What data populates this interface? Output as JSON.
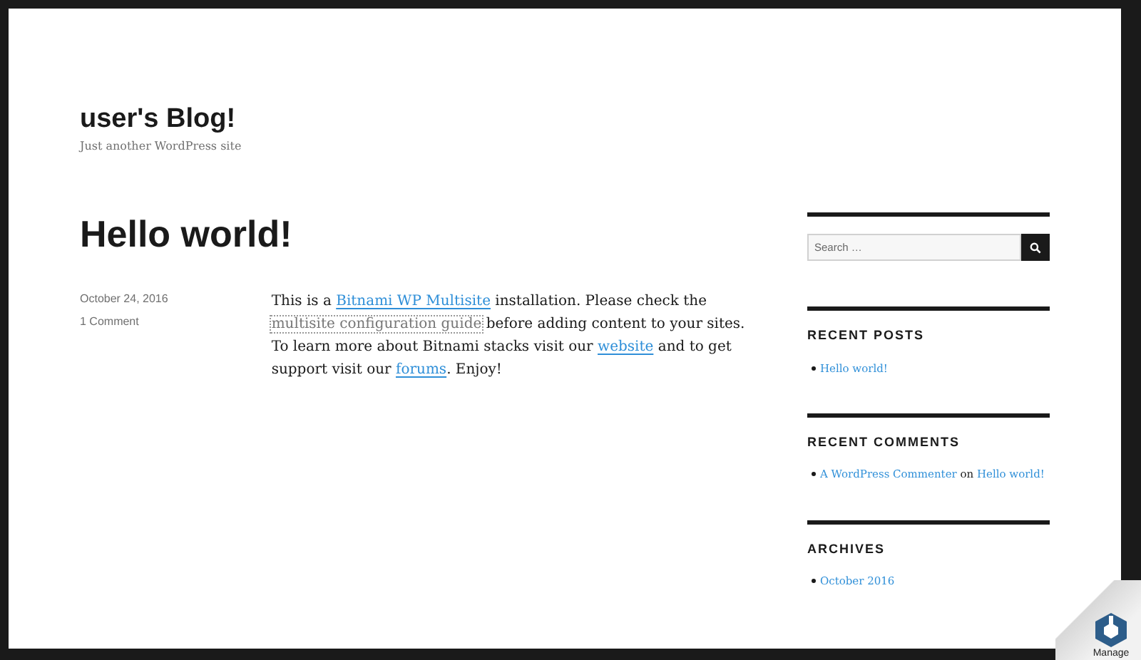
{
  "site": {
    "title": "user's Blog!",
    "tagline": "Just another WordPress site"
  },
  "post": {
    "title": "Hello world!",
    "date": "October 24, 2016",
    "comments": "1 Comment",
    "body": [
      {
        "kind": "text",
        "text": "This is a "
      },
      {
        "kind": "link",
        "text": "Bitnami WP Multisite"
      },
      {
        "kind": "text",
        "text": " installation. Please check the "
      },
      {
        "kind": "focused",
        "text": "multisite configuration guide"
      },
      {
        "kind": "text",
        "text": " before adding content to your sites. To learn more about Bitnami stacks visit our "
      },
      {
        "kind": "link",
        "text": "website"
      },
      {
        "kind": "text",
        "text": " and to get support visit our "
      },
      {
        "kind": "link",
        "text": "forums"
      },
      {
        "kind": "text",
        "text": ". Enjoy!"
      }
    ]
  },
  "sidebar": {
    "search": {
      "placeholder": "Search …"
    },
    "widgets": [
      {
        "title": "RECENT POSTS",
        "items": [
          [
            {
              "kind": "link",
              "text": "Hello world!"
            }
          ]
        ]
      },
      {
        "title": "RECENT COMMENTS",
        "items": [
          [
            {
              "kind": "link",
              "text": "A WordPress Commenter"
            },
            {
              "kind": "text",
              "text": " on "
            },
            {
              "kind": "link",
              "text": "Hello world!"
            }
          ]
        ]
      },
      {
        "title": "ARCHIVES",
        "items": [
          [
            {
              "kind": "link",
              "text": "October 2016"
            }
          ]
        ]
      }
    ]
  },
  "manage_badge": {
    "label": "Manage"
  }
}
